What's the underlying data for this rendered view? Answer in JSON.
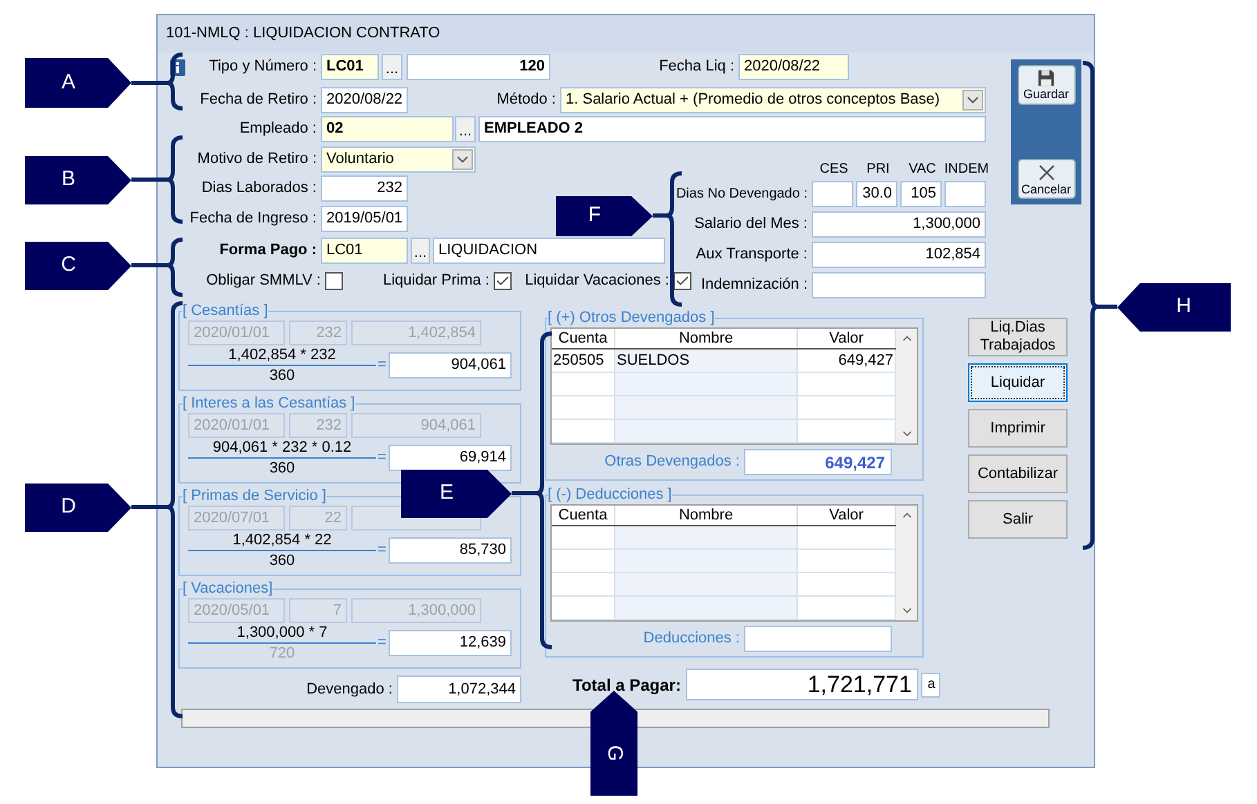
{
  "window": {
    "title": "101-NMLQ : LIQUIDACION CONTRATO"
  },
  "header": {
    "tipo_numero": {
      "label": "Tipo y Número :",
      "code": "LC01",
      "lookup": "...",
      "number": "120"
    },
    "fecha_liq": {
      "label": "Fecha Liq :",
      "value": "2020/08/22"
    },
    "fecha_retiro": {
      "label": "Fecha de Retiro :",
      "value": "2020/08/22"
    },
    "metodo": {
      "label": "Método :",
      "value": "1. Salario Actual + (Promedio de otros conceptos Base)"
    },
    "empleado": {
      "label": "Empleado :",
      "code": "02",
      "lookup": "...",
      "name": "EMPLEADO 2"
    },
    "motivo_retiro": {
      "label": "Motivo de Retiro :",
      "value": "Voluntario"
    },
    "dias_laborados": {
      "label": "Dias Laborados :",
      "value": "232"
    },
    "fecha_ingreso": {
      "label": "Fecha de Ingreso :",
      "value": "2019/05/01"
    },
    "forma_pago": {
      "label": "Forma Pago :",
      "code": "LC01",
      "lookup": "...",
      "name": "LIQUIDACION"
    },
    "options": [
      {
        "label": "Obligar SMMLV :",
        "checked": false
      },
      {
        "label": "Liquidar Prima :",
        "checked": true
      },
      {
        "label": "Liquidar Vacaciones :",
        "checked": true
      }
    ]
  },
  "dias_no_devengado": {
    "label": "Dias No Devengado :",
    "columns": [
      {
        "header": "CES"
      },
      {
        "header": "PRI",
        "value": "30.0"
      },
      {
        "header": "VAC",
        "value": "105"
      },
      {
        "header": "INDEM"
      }
    ]
  },
  "salary_fields": [
    {
      "label": "Salario del Mes :",
      "value": "1,300,000"
    },
    {
      "label": "Aux Transporte :",
      "value": "102,854"
    },
    {
      "label": "Indemnización :"
    }
  ],
  "toolbar": [
    {
      "label": "Guardar",
      "kind": "save"
    },
    {
      "label": "Cancelar",
      "kind": "cancel"
    }
  ],
  "calculations": [
    {
      "title": "[ Cesantías ]",
      "fields": [
        "2020/01/01",
        "232",
        "1,402,854"
      ],
      "numerator": "1,402,854 * 232",
      "operator": "=",
      "denominator": "360",
      "denominator_muted": false,
      "result": "904,061"
    },
    {
      "title": "[ Interes a las Cesantías ]",
      "fields": [
        "2020/01/01",
        "232",
        "904,061"
      ],
      "numerator": "904,061 * 232 * 0.12",
      "operator": "=",
      "denominator": "360",
      "denominator_muted": false,
      "result": "69,914"
    },
    {
      "title": "[ Primas de Servicio ]",
      "fields": [
        "2020/07/01",
        "22"
      ],
      "numerator": "1,402,854 * 22",
      "operator": "=",
      "denominator": "360",
      "denominator_muted": false,
      "result": "85,730"
    },
    {
      "title": "[ Vacaciones]",
      "fields": [
        "2020/05/01",
        "7",
        "1,300,000"
      ],
      "numerator": "1,300,000 * 7",
      "operator": "=",
      "denominator": "720",
      "denominator_muted": true,
      "result": "12,639"
    }
  ],
  "devengado": {
    "label": "Devengado :",
    "value": "1,072,344"
  },
  "grids": [
    {
      "title": "[ (+)  Otros Devengados ]",
      "columns": [
        "Cuenta",
        "Nombre",
        "Valor"
      ],
      "rows": [
        [
          "250505",
          "SUELDOS",
          "649,427"
        ]
      ],
      "total_label": "Otras Devengados :",
      "total": "649,427"
    },
    {
      "title": "[ (-)  Deducciones ]",
      "columns": [
        "Cuenta",
        "Nombre",
        "Valor"
      ],
      "total_label": "Deducciones :"
    }
  ],
  "actions": [
    {
      "label": "Liq.Dias Trabajados",
      "focused": false
    },
    {
      "label": "Liquidar",
      "focused": true
    },
    {
      "label": "Imprimir",
      "focused": false
    },
    {
      "label": "Contabilizar",
      "focused": false
    },
    {
      "label": "Salir",
      "focused": false
    }
  ],
  "total": {
    "label": "Total a Pagar:",
    "value": "1,721,771",
    "suffix": "a"
  },
  "callouts": [
    {
      "label": "A"
    },
    {
      "label": "B"
    },
    {
      "label": "C"
    },
    {
      "label": "D"
    },
    {
      "label": "E"
    },
    {
      "label": "F"
    },
    {
      "label": "G"
    },
    {
      "label": "H"
    }
  ]
}
